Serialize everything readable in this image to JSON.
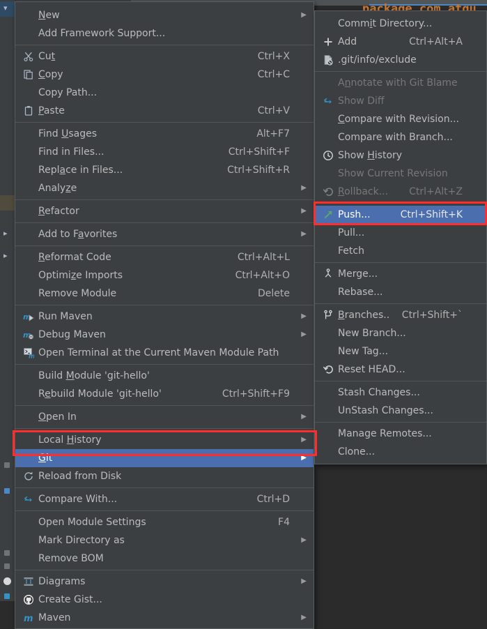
{
  "app": {
    "editor_code": "package com.atgu",
    "theme_colors": {
      "menu_background": "#3c3f41",
      "menu_border": "#5a5d5e",
      "text": "#bbbbbb",
      "disabled_text": "#777777",
      "selection": "#4b6eaf",
      "annotation": "#ff2d2d",
      "editor_background": "#2b2b2b",
      "tree_selection": "#2f4a63",
      "icon_blue": "#3592c4",
      "icon_green": "#59a869"
    }
  },
  "main_menu": {
    "name": "project-view-context-menu",
    "groups": [
      {
        "items": [
          {
            "label": "New",
            "mnemonic": "N",
            "icon": "none",
            "shortcut": "",
            "submenu": true,
            "state": "normal"
          },
          {
            "label": "Add Framework Support...",
            "mnemonic": "",
            "icon": "none",
            "shortcut": "",
            "submenu": false,
            "state": "normal"
          }
        ]
      },
      {
        "items": [
          {
            "label": "Cut",
            "mnemonic": "t",
            "icon": "scissors-icon",
            "shortcut": "Ctrl+X",
            "submenu": false,
            "state": "normal"
          },
          {
            "label": "Copy",
            "mnemonic": "C",
            "icon": "copy-icon",
            "shortcut": "Ctrl+C",
            "submenu": false,
            "state": "normal"
          },
          {
            "label": "Copy Path...",
            "mnemonic": "",
            "icon": "none",
            "shortcut": "",
            "submenu": false,
            "state": "normal"
          },
          {
            "label": "Paste",
            "mnemonic": "P",
            "icon": "clipboard-icon",
            "shortcut": "Ctrl+V",
            "submenu": false,
            "state": "normal"
          }
        ]
      },
      {
        "items": [
          {
            "label": "Find Usages",
            "mnemonic": "U",
            "icon": "none",
            "shortcut": "Alt+F7",
            "submenu": false,
            "state": "normal"
          },
          {
            "label": "Find in Files...",
            "mnemonic": "",
            "icon": "none",
            "shortcut": "Ctrl+Shift+F",
            "submenu": false,
            "state": "normal"
          },
          {
            "label": "Replace in Files...",
            "mnemonic": "a",
            "icon": "none",
            "shortcut": "Ctrl+Shift+R",
            "submenu": false,
            "state": "normal"
          },
          {
            "label": "Analyze",
            "mnemonic": "z",
            "icon": "none",
            "shortcut": "",
            "submenu": true,
            "state": "normal"
          }
        ]
      },
      {
        "items": [
          {
            "label": "Refactor",
            "mnemonic": "R",
            "icon": "none",
            "shortcut": "",
            "submenu": true,
            "state": "normal"
          }
        ]
      },
      {
        "items": [
          {
            "label": "Add to Favorites",
            "mnemonic": "a",
            "icon": "none",
            "shortcut": "",
            "submenu": true,
            "state": "normal"
          }
        ]
      },
      {
        "items": [
          {
            "label": "Reformat Code",
            "mnemonic": "R",
            "icon": "none",
            "shortcut": "Ctrl+Alt+L",
            "submenu": false,
            "state": "normal"
          },
          {
            "label": "Optimize Imports",
            "mnemonic": "z",
            "icon": "none",
            "shortcut": "Ctrl+Alt+O",
            "submenu": false,
            "state": "normal"
          },
          {
            "label": "Remove Module",
            "mnemonic": "",
            "icon": "none",
            "shortcut": "Delete",
            "submenu": false,
            "state": "normal"
          }
        ]
      },
      {
        "items": [
          {
            "label": "Run Maven",
            "mnemonic": "",
            "icon": "maven-run-icon",
            "shortcut": "",
            "submenu": true,
            "state": "normal"
          },
          {
            "label": "Debug Maven",
            "mnemonic": "",
            "icon": "maven-debug-icon",
            "shortcut": "",
            "submenu": true,
            "state": "normal"
          },
          {
            "label": "Open Terminal at the Current Maven Module Path",
            "mnemonic": "",
            "icon": "maven-terminal-icon",
            "shortcut": "",
            "submenu": false,
            "state": "normal"
          }
        ]
      },
      {
        "items": [
          {
            "label": "Build Module 'git-hello'",
            "mnemonic": "M",
            "icon": "none",
            "shortcut": "",
            "submenu": false,
            "state": "normal"
          },
          {
            "label": "Rebuild Module 'git-hello'",
            "mnemonic": "e",
            "icon": "none",
            "shortcut": "Ctrl+Shift+F9",
            "submenu": false,
            "state": "normal"
          }
        ]
      },
      {
        "items": [
          {
            "label": "Open In",
            "mnemonic": "O",
            "icon": "none",
            "shortcut": "",
            "submenu": true,
            "state": "normal"
          }
        ]
      },
      {
        "items": [
          {
            "label": "Local History",
            "mnemonic": "H",
            "icon": "none",
            "shortcut": "",
            "submenu": true,
            "state": "normal"
          },
          {
            "label": "Git",
            "mnemonic": "G",
            "icon": "none",
            "shortcut": "",
            "submenu": true,
            "state": "selected"
          },
          {
            "label": "Reload from Disk",
            "mnemonic": "",
            "icon": "reload-icon",
            "shortcut": "",
            "submenu": false,
            "state": "normal"
          }
        ]
      },
      {
        "items": [
          {
            "label": "Compare With...",
            "mnemonic": "",
            "icon": "compare-icon",
            "shortcut": "Ctrl+D",
            "submenu": false,
            "state": "normal"
          }
        ]
      },
      {
        "items": [
          {
            "label": "Open Module Settings",
            "mnemonic": "",
            "icon": "none",
            "shortcut": "F4",
            "submenu": false,
            "state": "normal"
          },
          {
            "label": "Mark Directory as",
            "mnemonic": "",
            "icon": "none",
            "shortcut": "",
            "submenu": true,
            "state": "normal"
          },
          {
            "label": "Remove BOM",
            "mnemonic": "",
            "icon": "none",
            "shortcut": "",
            "submenu": false,
            "state": "normal"
          }
        ]
      },
      {
        "items": [
          {
            "label": "Diagrams",
            "mnemonic": "",
            "icon": "diagram-icon",
            "shortcut": "",
            "submenu": true,
            "state": "normal"
          },
          {
            "label": "Create Gist...",
            "mnemonic": "",
            "icon": "github-icon",
            "shortcut": "",
            "submenu": false,
            "state": "normal"
          },
          {
            "label": "Maven",
            "mnemonic": "",
            "icon": "maven-icon",
            "shortcut": "",
            "submenu": true,
            "state": "normal"
          }
        ]
      }
    ]
  },
  "git_submenu": {
    "name": "git-submenu",
    "groups": [
      {
        "items": [
          {
            "label": "Commit Directory...",
            "mnemonic": "i",
            "icon": "none",
            "shortcut": "",
            "submenu": false,
            "state": "normal"
          },
          {
            "label": "Add",
            "mnemonic": "",
            "icon": "plus-icon",
            "shortcut": "Ctrl+Alt+A",
            "submenu": false,
            "state": "normal"
          },
          {
            "label": ".git/info/exclude",
            "mnemonic": "",
            "icon": "ignore-file-icon",
            "shortcut": "",
            "submenu": false,
            "state": "normal"
          }
        ]
      },
      {
        "items": [
          {
            "label": "Annotate with Git Blame",
            "mnemonic": "n",
            "icon": "none",
            "shortcut": "",
            "submenu": false,
            "state": "disabled"
          },
          {
            "label": "Show Diff",
            "mnemonic": "",
            "icon": "compare-icon",
            "shortcut": "",
            "submenu": false,
            "state": "disabled"
          },
          {
            "label": "Compare with Revision...",
            "mnemonic": "C",
            "icon": "none",
            "shortcut": "",
            "submenu": false,
            "state": "normal"
          },
          {
            "label": "Compare with Branch...",
            "mnemonic": "",
            "icon": "none",
            "shortcut": "",
            "submenu": false,
            "state": "normal"
          },
          {
            "label": "Show History",
            "mnemonic": "H",
            "icon": "clock-icon",
            "shortcut": "",
            "submenu": false,
            "state": "normal"
          },
          {
            "label": "Show Current Revision",
            "mnemonic": "",
            "icon": "none",
            "shortcut": "",
            "submenu": false,
            "state": "disabled"
          },
          {
            "label": "Rollback...",
            "mnemonic": "R",
            "icon": "rollback-icon",
            "shortcut": "Ctrl+Alt+Z",
            "submenu": false,
            "state": "disabled"
          }
        ]
      },
      {
        "items": [
          {
            "label": "Push...",
            "mnemonic": "",
            "icon": "push-arrow-icon",
            "shortcut": "Ctrl+Shift+K",
            "submenu": false,
            "state": "selected"
          },
          {
            "label": "Pull...",
            "mnemonic": "",
            "icon": "none",
            "shortcut": "",
            "submenu": false,
            "state": "normal"
          },
          {
            "label": "Fetch",
            "mnemonic": "",
            "icon": "none",
            "shortcut": "",
            "submenu": false,
            "state": "normal"
          }
        ]
      },
      {
        "items": [
          {
            "label": "Merge...",
            "mnemonic": "",
            "icon": "merge-icon",
            "shortcut": "",
            "submenu": false,
            "state": "normal"
          },
          {
            "label": "Rebase...",
            "mnemonic": "",
            "icon": "none",
            "shortcut": "",
            "submenu": false,
            "state": "normal"
          }
        ]
      },
      {
        "items": [
          {
            "label": "Branches...",
            "mnemonic": "B",
            "icon": "branch-icon",
            "shortcut": "Ctrl+Shift+`",
            "submenu": false,
            "state": "normal"
          },
          {
            "label": "New Branch...",
            "mnemonic": "",
            "icon": "none",
            "shortcut": "",
            "submenu": false,
            "state": "normal"
          },
          {
            "label": "New Tag...",
            "mnemonic": "",
            "icon": "none",
            "shortcut": "",
            "submenu": false,
            "state": "normal"
          },
          {
            "label": "Reset HEAD...",
            "mnemonic": "",
            "icon": "reset-icon",
            "shortcut": "",
            "submenu": false,
            "state": "normal"
          }
        ]
      },
      {
        "items": [
          {
            "label": "Stash Changes...",
            "mnemonic": "",
            "icon": "none",
            "shortcut": "",
            "submenu": false,
            "state": "normal"
          },
          {
            "label": "UnStash Changes...",
            "mnemonic": "",
            "icon": "none",
            "shortcut": "",
            "submenu": false,
            "state": "normal"
          }
        ]
      },
      {
        "items": [
          {
            "label": "Manage Remotes...",
            "mnemonic": "",
            "icon": "none",
            "shortcut": "",
            "submenu": false,
            "state": "normal"
          },
          {
            "label": "Clone...",
            "mnemonic": "",
            "icon": "none",
            "shortcut": "",
            "submenu": false,
            "state": "normal"
          }
        ]
      }
    ]
  },
  "annotations": [
    {
      "name": "git-highlight-box",
      "target": "Git"
    },
    {
      "name": "push-highlight-box",
      "target": "Push..."
    }
  ]
}
